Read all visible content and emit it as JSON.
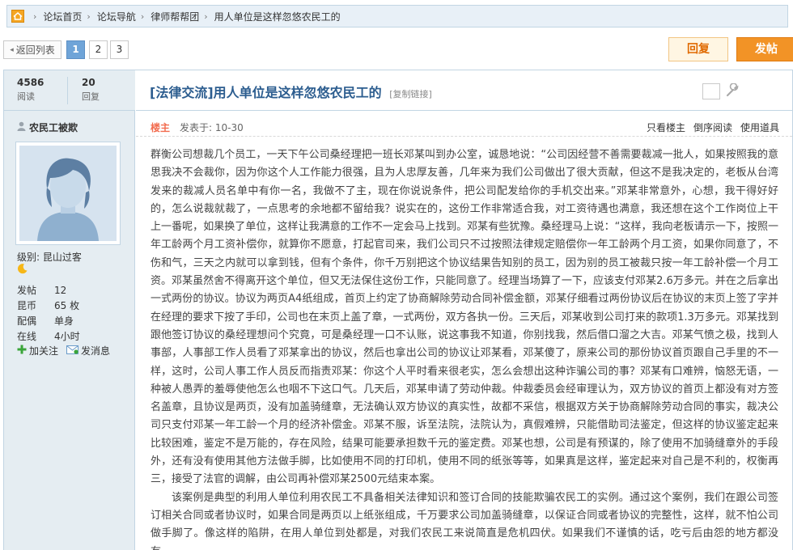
{
  "breadcrumb": {
    "items": [
      "论坛首页",
      "论坛导航",
      "律师帮帮团",
      "用人单位是这样忽悠农民工的"
    ],
    "separator": "›"
  },
  "toolbar": {
    "back_label": "返回列表",
    "pages": [
      "1",
      "2",
      "3"
    ],
    "current_page": "1",
    "reply_label": "回复",
    "post_label": "发帖"
  },
  "stats": {
    "views": "4586",
    "views_label": "阅读",
    "replies": "20",
    "replies_label": "回复"
  },
  "thread": {
    "tag": "[法律交流]",
    "title": "用人单位是这样忽悠农民工的",
    "copy_link": "[复制链接]"
  },
  "author": {
    "name": "农民工被欺",
    "level_label": "级别:",
    "level": "昆山过客",
    "info": [
      {
        "key": "发帖",
        "value": "12"
      },
      {
        "key": "昆币",
        "value": "65 枚"
      },
      {
        "key": "配偶",
        "value": "单身"
      },
      {
        "key": "在线",
        "value": "4小时"
      }
    ],
    "follow_label": "加关注",
    "message_label": "发消息"
  },
  "post_meta": {
    "floor": "楼主",
    "posted": "发表于: 10-30",
    "links": [
      "只看楼主",
      "倒序阅读",
      "使用道具"
    ]
  },
  "content": {
    "p1": "群衡公司想裁几个员工，一天下午公司桑经理把一班长邓某叫到办公室，诚恳地说：“公司因经营不善需要裁减一批人，如果按照我的意思我决不会裁你，因为你这个人工作能力很强，且为人忠厚友善，几年来为我们公司做出了很大贡献，但这不是我决定的，老板从台湾发来的裁减人员名单中有你一名，我做不了主，现在你说说条件，把公司配发给你的手机交出来。”邓某非常意外，心想，我干得好好的，怎么说裁就裁了，一点思考的余地都不留给我？说实在的，这份工作非常适合我，对工资待遇也满意，我还想在这个工作岗位上干上一番呢，如果换了单位，这样让我满意的工作不一定会马上找到。邓某有些犹豫。桑经理马上说：“这样，我向老板请示一下，按照一年工龄两个月工资补偿你，就算你不愿意，打起官司来，我们公司只不过按照法律规定赔偿你一年工龄两个月工资，如果你同意了，不伤和气，三天之内就可以拿到钱，但有个条件，你千万别把这个协议结果告知别的员工，因为别的员工被裁只按一年工龄补偿一个月工资。邓某虽然舍不得离开这个单位，但又无法保住这份工作，只能同意了。经理当场算了一下，应该支付邓某2.6万多元。并在之后拿出一式两份的协议。协议为两页A4纸组成，首页上约定了协商解除劳动合同补偿金额，邓某仔细看过两份协议后在协议的末页上签了字并在经理的要求下按了手印，公司也在末页上盖了章，一式两份，双方各执一份。三天后，邓某收到公司打来的款项1.3万多元。邓某找到跟他签订协议的桑经理想问个究竟，可是桑经理一口不认账，说这事我不知道，你别找我，然后借口溜之大吉。邓某气愤之极，找到人事部，人事部工作人员看了邓某拿出的协议，然后也拿出公司的协议让邓某看，邓某傻了，原来公司的那份协议首页跟自己手里的不一样，这时，公司人事工作人员反而指责邓某：你这个人平时看来很老实，怎么会想出这种诈骗公司的事？邓某有口难辨，恼怒无语，一种被人愚弄的羞辱使他怎么也咽不下这口气。几天后，邓某申请了劳动仲裁。仲裁委员会经审理认为，双方协议的首页上都没有对方签名盖章，且协议是两页，没有加盖骑缝章，无法确认双方协议的真实性，故都不采信，根据双方关于协商解除劳动合同的事实，裁决公司只支付邓某一年工龄一个月的经济补偿金。邓某不服，诉至法院，法院认为，真假难辨，只能借助司法鉴定，但这样的协议鉴定起来比较困难，鉴定不是万能的，存在风险，结果可能要承担数千元的鉴定费。邓某也想，公司是有预谋的，除了使用不加骑缝章外的手段外，还有没有使用其他方法做手脚，比如使用不同的打印机，使用不同的纸张等等，如果真是这样，鉴定起来对自己是不利的，权衡再三，接受了法官的调解，由公司再补偿邓某2500元结束本案。",
    "p2": "该案例是典型的利用人单位利用农民工不具备相关法律知识和签订合同的技能欺骗农民工的实例。通过这个案例，我们在跟公司签订相关合同或者协议时，如果合同是两页以上纸张组成，千万要求公司加盖骑缝章，以保证合同或者协议的完整性，这样，就不怕公司做手脚了。像这样的陷阱，在用人单位到处都是，对我们农民工来说简直是危机四伏。如果我们不谨慎的话，吃亏后由怨的地方都没有。"
  }
}
